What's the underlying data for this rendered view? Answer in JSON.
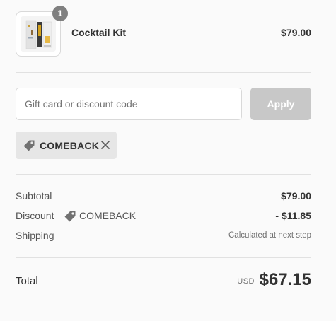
{
  "line_items": [
    {
      "name": "Cocktail Kit",
      "price": "$79.00",
      "quantity": "1"
    }
  ],
  "discount_form": {
    "placeholder": "Gift card or discount code",
    "apply_label": "Apply"
  },
  "applied_code": {
    "code": "COMEBACK"
  },
  "summary": {
    "subtotal_label": "Subtotal",
    "subtotal_value": "$79.00",
    "discount_label": "Discount",
    "discount_code": "COMEBACK",
    "discount_value": "- $11.85",
    "shipping_label": "Shipping",
    "shipping_value": "Calculated at next step"
  },
  "total": {
    "label": "Total",
    "currency": "USD",
    "amount": "$67.15"
  },
  "colors": {
    "background": "#fafafa",
    "apply_button": "#c8c8c8",
    "chip_background": "#e6e6e6",
    "badge": "#727272"
  }
}
